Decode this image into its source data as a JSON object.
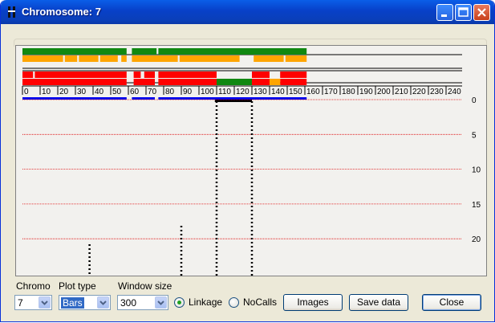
{
  "window": {
    "title": "Chromosome: 7",
    "app_icon": "chromosome-icon",
    "controls": [
      "minimize-icon",
      "maximize-icon",
      "close-icon"
    ]
  },
  "plot": {
    "ruler_ticks": [
      "0",
      "10",
      "20",
      "30",
      "40",
      "50",
      "60",
      "70",
      "80",
      "90",
      "100",
      "110",
      "120",
      "130",
      "140",
      "150",
      "160",
      "170",
      "180",
      "190",
      "200",
      "210",
      "220",
      "230",
      "240"
    ],
    "y_ticks": [
      "0",
      "5",
      "10",
      "15",
      "20"
    ],
    "colors": {
      "green": "#118811",
      "orange": "#ffa500",
      "red": "#ff0000",
      "blue": "#0000ee",
      "grid": "#dd0000"
    }
  },
  "controls": {
    "chromo_label": "Chromo",
    "chromo_value": "7",
    "plot_type_label": "Plot type",
    "plot_type_value": "Bars",
    "window_size_label": "Window size",
    "window_size_value": "300",
    "radio_linkage_label": "Linkage",
    "radio_linkage_checked": true,
    "radio_nocalls_label": "NoCalls",
    "radio_nocalls_checked": false,
    "images_button": "Images",
    "save_data_button": "Save data",
    "close_button": "Close"
  }
}
